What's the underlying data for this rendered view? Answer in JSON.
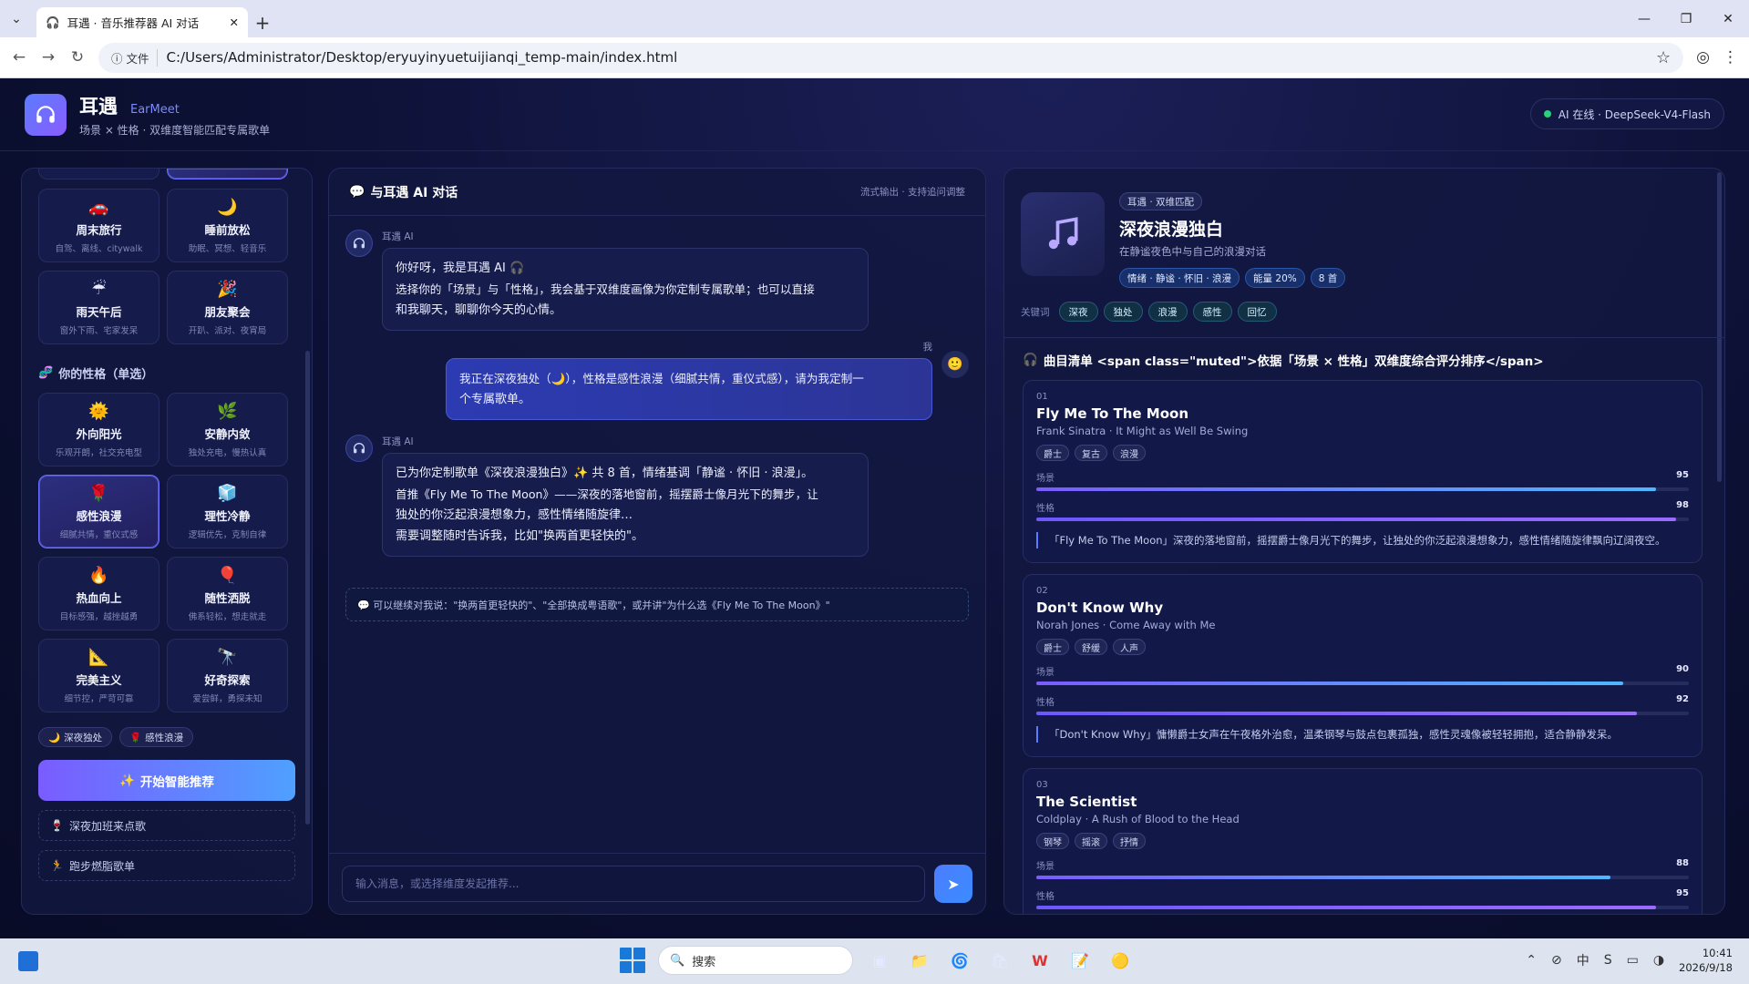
{
  "browser": {
    "tab_title": "耳遇 · 音乐推荐器 AI 对话",
    "address_badge": "文件",
    "url": "C:/Users/Administrator/Desktop/eryuyinyuetuijianqi_temp-main/index.html"
  },
  "header": {
    "title": "耳遇",
    "title_en": "EarMeet",
    "subtitle": "场景 × 性格 · 双维度智能匹配专属歌单",
    "status": "AI 在线 · DeepSeek-V4-Flash"
  },
  "scenes": [
    {
      "icon": "🚗",
      "name": "周末旅行",
      "desc": "自驾、离线、citywalk"
    },
    {
      "icon": "🌙",
      "name": "睡前放松",
      "desc": "助眠、冥想、轻音乐"
    },
    {
      "icon": "☔",
      "name": "雨天午后",
      "desc": "窗外下雨、宅家发呆"
    },
    {
      "icon": "🎉",
      "name": "朋友聚会",
      "desc": "开趴、派对、夜宵局"
    }
  ],
  "personality": {
    "title": "你的性格（单选）",
    "items": [
      {
        "icon": "🌞",
        "name": "外向阳光",
        "desc": "乐观开朗，社交充电型"
      },
      {
        "icon": "🌿",
        "name": "安静内敛",
        "desc": "独处充电，慢热认真"
      },
      {
        "icon": "🌹",
        "name": "感性浪漫",
        "desc": "细腻共情，重仪式感"
      },
      {
        "icon": "🧊",
        "name": "理性冷静",
        "desc": "逻辑优先，克制自律"
      },
      {
        "icon": "🔥",
        "name": "热血向上",
        "desc": "目标感强，越挫越勇"
      },
      {
        "icon": "🎈",
        "name": "随性洒脱",
        "desc": "佛系轻松，想走就走"
      },
      {
        "icon": "📐",
        "name": "完美主义",
        "desc": "细节控，严苛可靠"
      },
      {
        "icon": "🔭",
        "name": "好奇探索",
        "desc": "爱尝鲜，勇探未知"
      }
    ]
  },
  "selected_chips": [
    {
      "icon": "🌙",
      "label": "深夜独处"
    },
    {
      "icon": "🌹",
      "label": "感性浪漫"
    }
  ],
  "start_button": "开始智能推荐",
  "quick_prompts": [
    {
      "icon": "🍷",
      "label": "深夜加班来点歌"
    },
    {
      "icon": "🏃",
      "label": "跑步燃脂歌单"
    }
  ],
  "chat": {
    "title": "与耳遇 AI 对话",
    "hint": "流式输出 · 支持追问调整",
    "ai_name": "耳遇 AI",
    "user_name": "我",
    "msg1": [
      "你好呀，我是耳遇 AI 🎧",
      "选择你的「场景」与「性格」，我会基于双维度画像为你定制专属歌单；也可以直接",
      "和我聊天，聊聊你今天的心情。"
    ],
    "user_msg": [
      "我正在深夜独处（🌙），性格是感性浪漫（细腻共情，重仪式感），请为我定制一",
      "个专属歌单。"
    ],
    "msg2": [
      "已为你定制歌单《深夜浪漫独白》✨ 共 8 首，情绪基调「静谧 · 怀旧 · 浪漫」。",
      "首推《Fly Me To The Moon》——深夜的落地窗前，摇摆爵士像月光下的舞步，让",
      "独处的你泛起浪漫想象力，感性情绪随旋律…",
      "需要调整随时告诉我，比如\"换两首更轻快的\"。"
    ],
    "followup": "💬 可以继续对我说：\"换两首更轻快的\"、\"全部换成粤语歌\"，或并讲\"为什么选《Fly Me To The Moon》\"",
    "input_placeholder": "输入消息，或选择维度发起推荐..."
  },
  "playlist": {
    "badge": "耳遇 · 双维匹配",
    "title": "深夜浪漫独白",
    "desc": "在静谧夜色中与自己的浪漫对话",
    "meta": [
      "情绪 · 静谧 · 怀旧 · 浪漫",
      "能量 20%",
      "8 首"
    ],
    "kw_label": "关键词",
    "keywords": [
      "深夜",
      "独处",
      "浪漫",
      "感性",
      "回忆"
    ],
    "list_title": "曲目清单 <span class=\"muted\">依据「场景 × 性格」双维度综合评分排序</span>",
    "score_labels": {
      "scene": "场景",
      "persona": "性格"
    },
    "songs": [
      {
        "no": "01",
        "title": "Fly Me To The Moon",
        "artist": "Frank Sinatra · It Might as Well Be Swing",
        "tags": [
          "爵士",
          "复古",
          "浪漫"
        ],
        "scene": 95,
        "persona": 98,
        "reason": "「Fly Me To The Moon」深夜的落地窗前，摇摆爵士像月光下的舞步，让独处的你泛起浪漫想象力，感性情绪随旋律飘向辽阔夜空。"
      },
      {
        "no": "02",
        "title": "Don't Know Why",
        "artist": "Norah Jones · Come Away with Me",
        "tags": [
          "爵士",
          "舒缓",
          "人声"
        ],
        "scene": 90,
        "persona": 92,
        "reason": "「Don't Know Why」慵懒爵士女声在午夜格外治愈，温柔钢琴与鼓点包裹孤独，感性灵魂像被轻轻拥抱，适合静静发呆。"
      },
      {
        "no": "03",
        "title": "The Scientist",
        "artist": "Coldplay · A Rush of Blood to the Head",
        "tags": [
          "钢琴",
          "摇滚",
          "抒情"
        ],
        "scene": 88,
        "persona": 95,
        "reason": ""
      }
    ]
  },
  "taskbar": {
    "search": "搜索",
    "time": "10:41",
    "date": "2026/9/18"
  }
}
